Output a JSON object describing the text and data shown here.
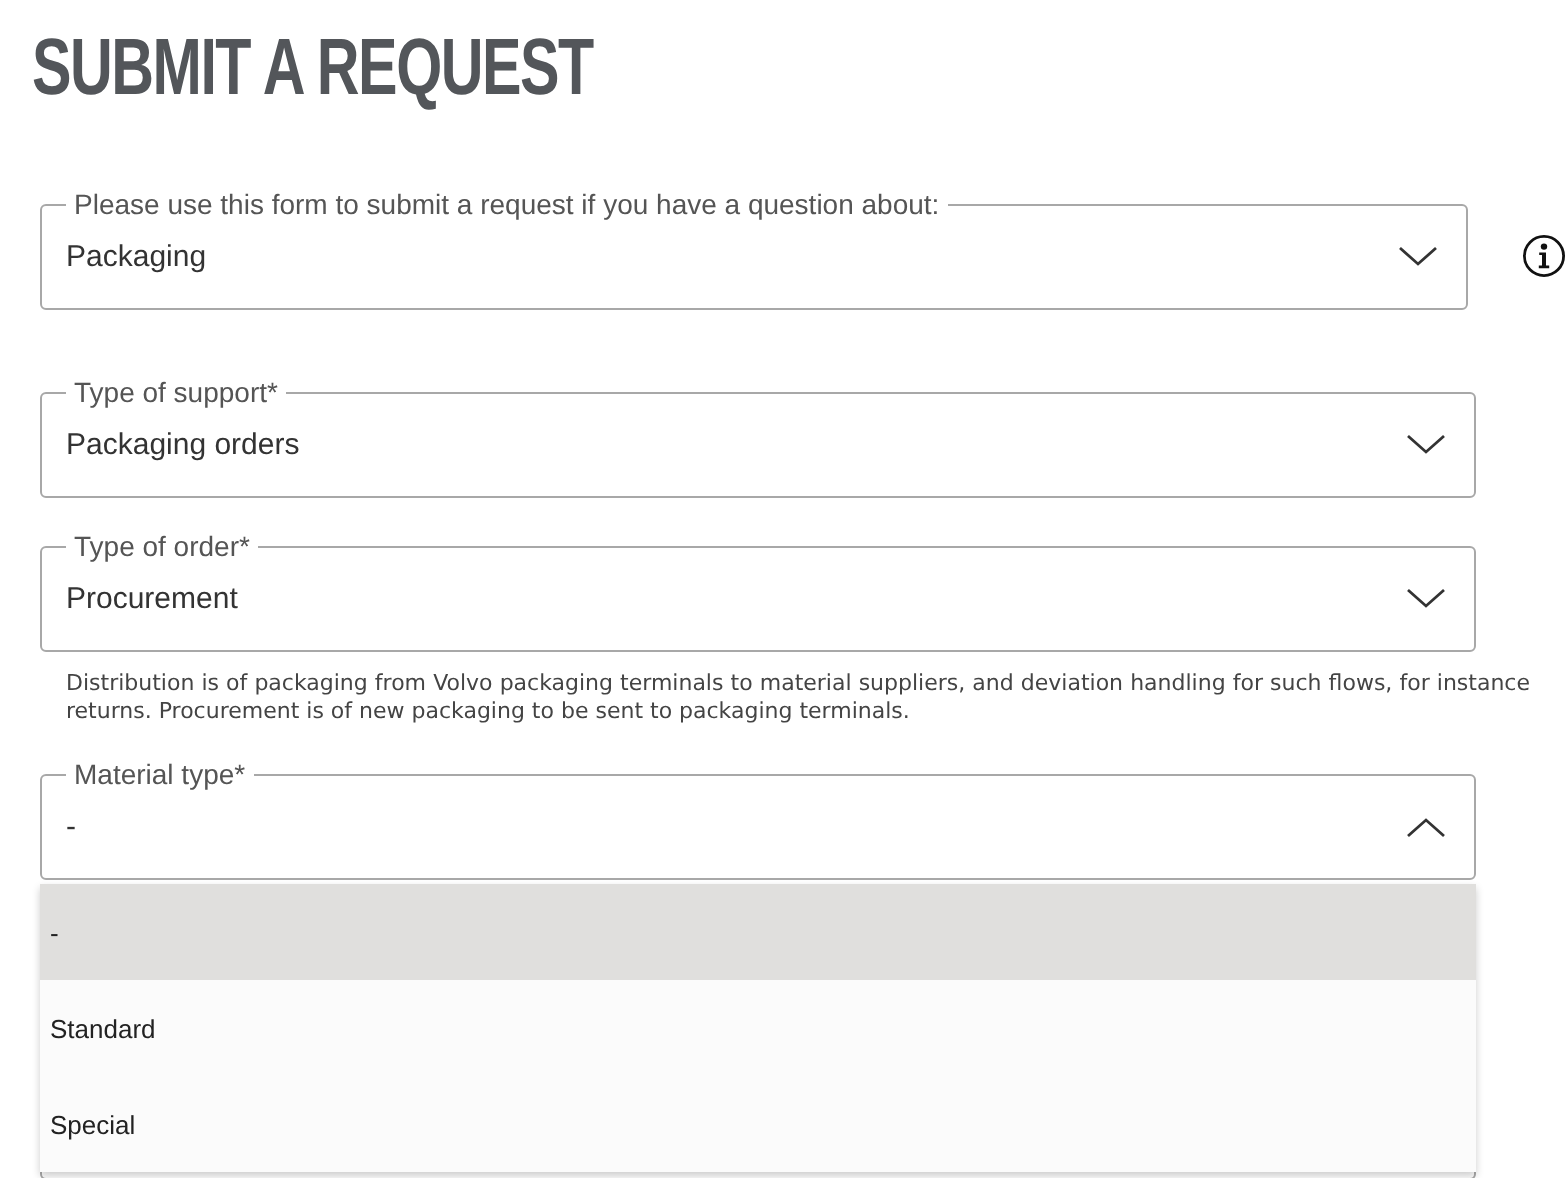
{
  "page_title": "SUBMIT A REQUEST",
  "fields": [
    {
      "label": "Please use this form to submit a request if you have a question about:",
      "value": "Packaging",
      "expanded": false,
      "info": true
    },
    {
      "label": "Type of support*",
      "value": "Packaging orders",
      "expanded": false
    },
    {
      "label": "Type of order*",
      "value": "Procurement",
      "expanded": false,
      "help": "Distribution is of packaging from Volvo packaging terminals to material suppliers, and deviation handling for such flows, for instance returns. Procurement is of new packaging to be sent to packaging terminals."
    },
    {
      "label": "Material type*",
      "value": "-",
      "expanded": true,
      "options": [
        {
          "label": "-",
          "selected": true
        },
        {
          "label": "Standard",
          "selected": false
        },
        {
          "label": "Special",
          "selected": false
        }
      ]
    }
  ]
}
